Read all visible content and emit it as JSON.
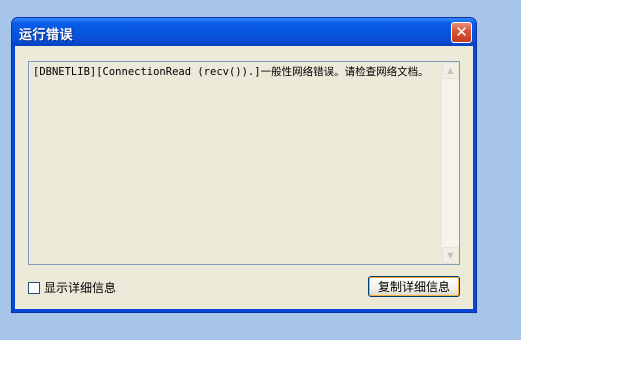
{
  "window": {
    "title": "运行错误",
    "close_glyph": "✕"
  },
  "error": {
    "message": "[DBNETLIB][ConnectionRead (recv()).]一般性网络错误。请检查网络文档。"
  },
  "scrollbar": {
    "up_glyph": "▲",
    "down_glyph": "▼"
  },
  "details": {
    "checkbox_label": "显示详细信息",
    "checked": false
  },
  "buttons": {
    "copy_label": "复制详细信息"
  },
  "colors": {
    "desktop": "#a6c5e8",
    "titlebar": "#0654e0",
    "client": "#ece9d8",
    "close_button": "#d8563a"
  }
}
